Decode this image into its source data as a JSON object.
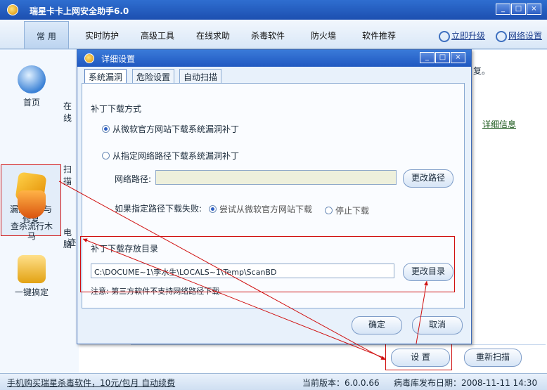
{
  "window": {
    "title": "瑞星卡卡上网安全助手6.0",
    "controls": [
      "_",
      "□",
      "×"
    ]
  },
  "menu": {
    "items": [
      "常 用",
      "实时防护",
      "高级工具",
      "在线求助",
      "杀毒软件",
      "防火墙",
      "软件推荐"
    ],
    "upgrade": "立即升级",
    "network": "网络设置"
  },
  "leftnav": {
    "items": [
      "首页",
      "漏洞扫描与修复",
      "查杀流行木马",
      "一键搞定"
    ],
    "partial": [
      "在线",
      "扫描",
      "电脑",
      "迹"
    ]
  },
  "background": {
    "text_fragment": "复。",
    "details_link": "详细信息",
    "settings_button": "设 置",
    "rescan_button": "重新扫描"
  },
  "dialog": {
    "title": "详细设置",
    "tabs": [
      "系统漏洞",
      "危险设置",
      "自动扫描"
    ],
    "download_method_title": "补丁下载方式",
    "radio_official": "从微软官方网站下载系统漏洞补丁",
    "radio_custom": "从指定网络路径下载系统漏洞补丁",
    "net_path_label": "网络路径:",
    "net_path_value": "",
    "change_path_button": "更改路径",
    "fail_label": "如果指定路径下载失败:",
    "fail_option_retry": "尝试从微软官方网站下载",
    "fail_option_stop": "停止下载",
    "dir_title": "补丁下载存放目录",
    "dir_value": "C:\\DOCUME~1\\李水生\\LOCALS~1\\Temp\\ScanBD",
    "change_dir_button": "更改目录",
    "note": "注意: 第三方软件不支持网络路径下载.",
    "ok_button": "确定",
    "cancel_button": "取消"
  },
  "statusbar": {
    "promo": "手机购买瑞星杀毒软件，10元/包月 自动续费",
    "version_label": "当前版本：6.0.0.66",
    "db_date_label": "病毒库发布日期：2008-11-11 14:30"
  },
  "colors": {
    "accent": "#2058c0",
    "highlight_box": "#d01010",
    "link_green": "#1d5a1d"
  }
}
